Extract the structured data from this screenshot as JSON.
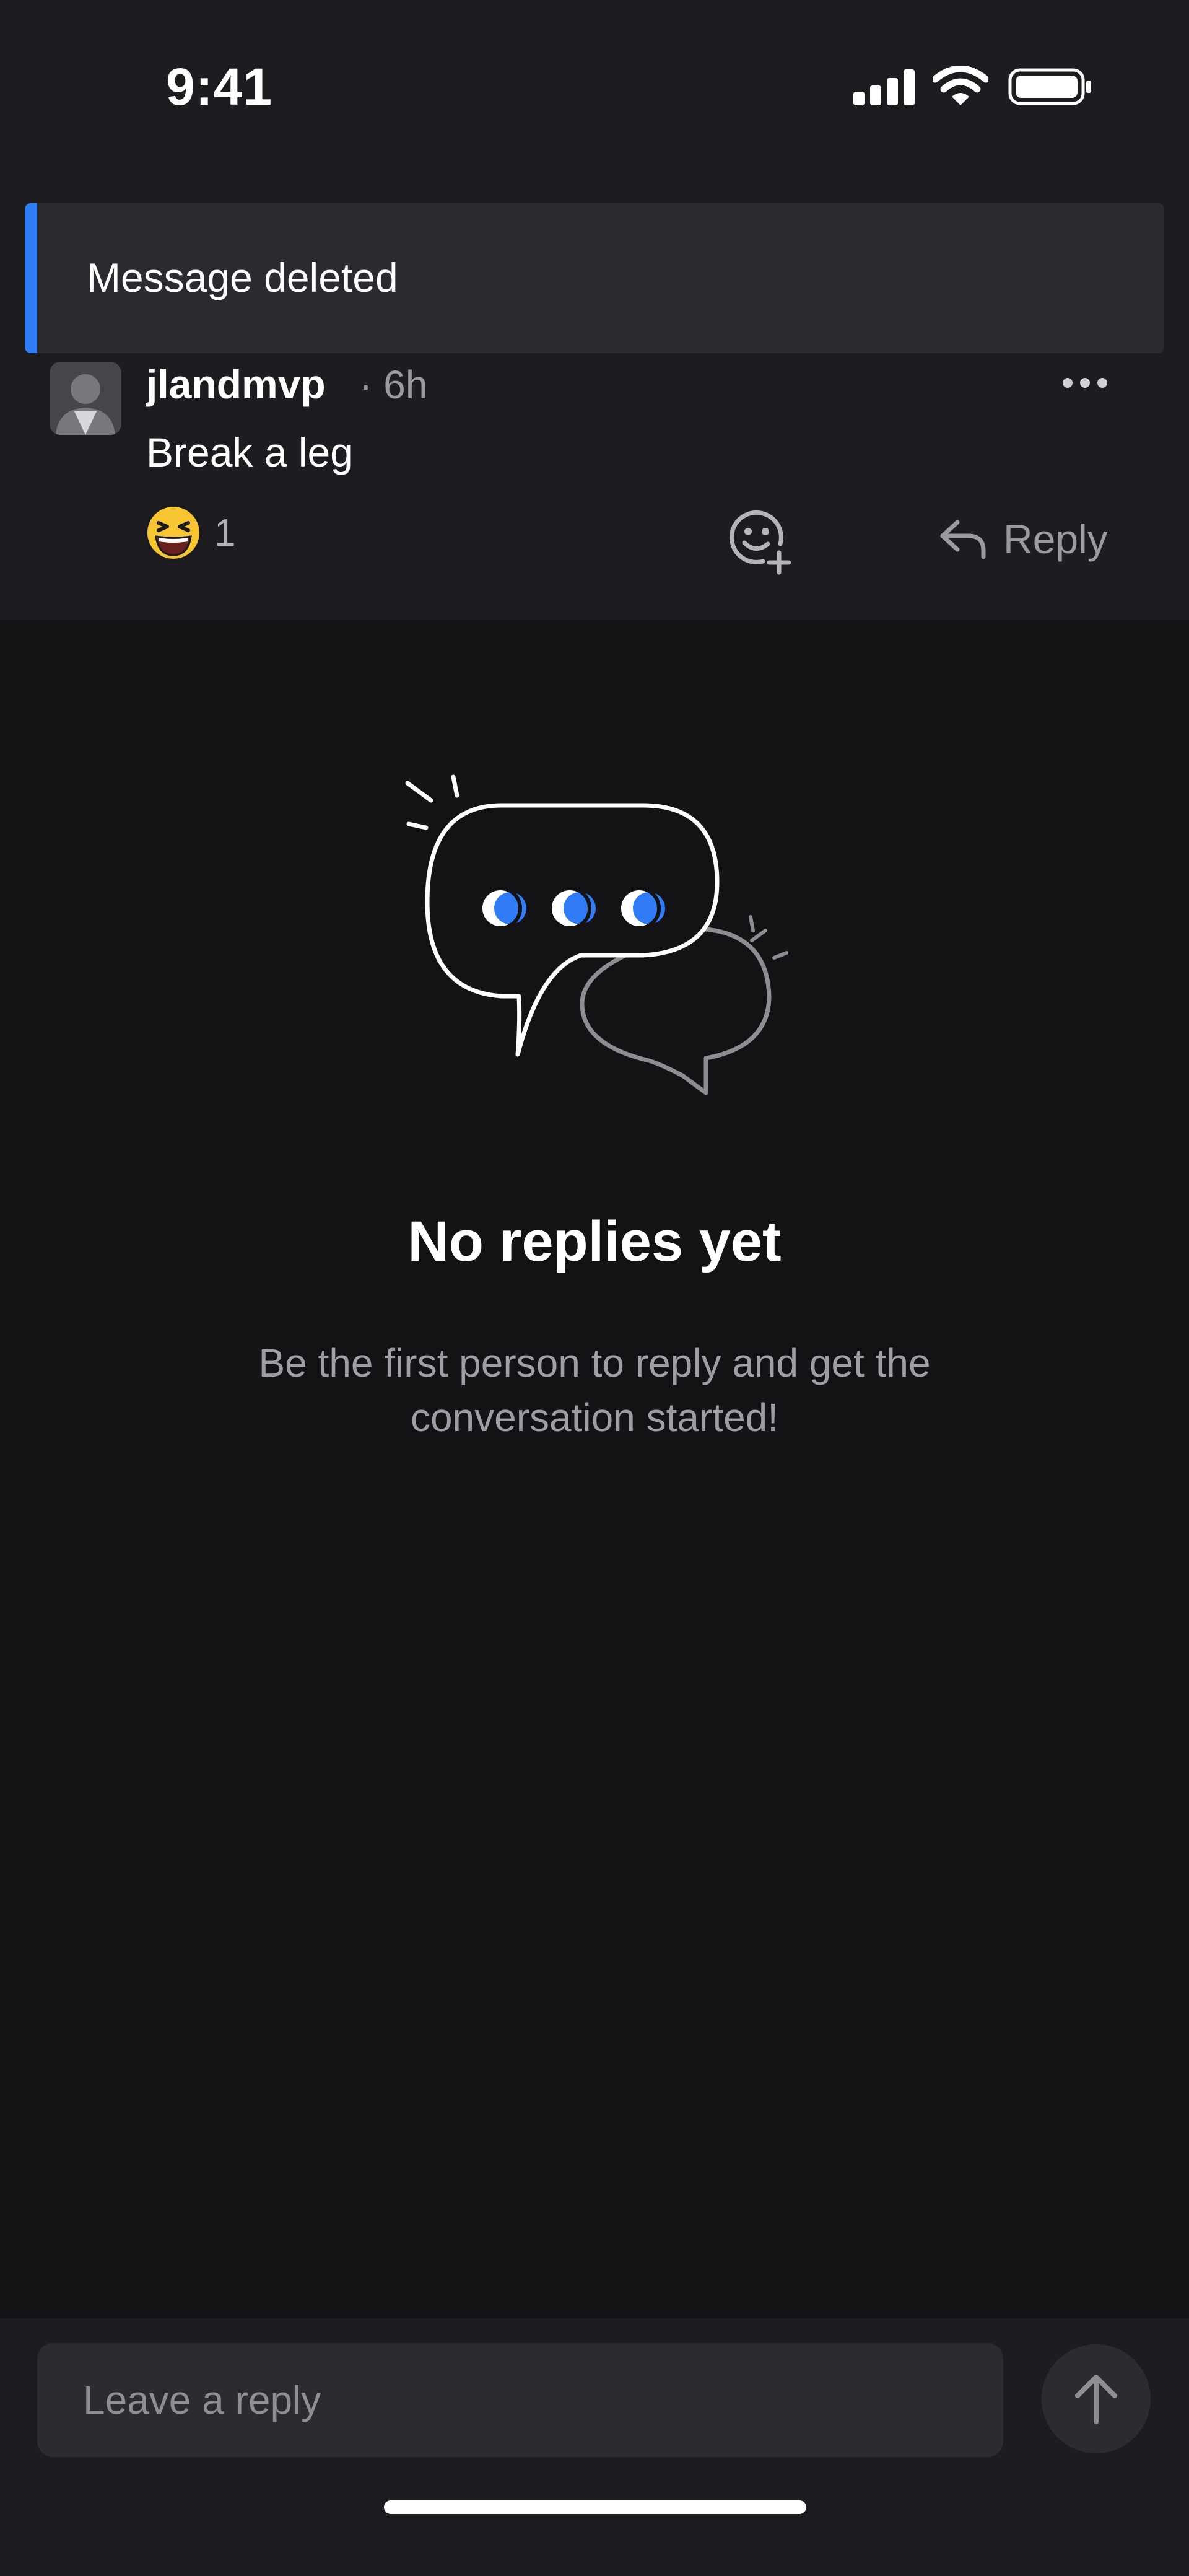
{
  "status_bar": {
    "time": "9:41",
    "icons": [
      "cellular-signal-icon",
      "wifi-icon",
      "battery-icon"
    ]
  },
  "deleted_banner": {
    "text": "Message deleted",
    "accent_color": "#2f7cf6"
  },
  "message": {
    "author": "jlandmvp",
    "time": "· 6h",
    "body": "Break a leg",
    "reaction": {
      "icon": "laughing-emoji-icon",
      "count": "1"
    },
    "add_reaction_icon": "add-emoji-icon",
    "reply_label": "Reply",
    "more_icon": "more-dots-icon"
  },
  "empty_state": {
    "illustration": "chat-bubbles-icon",
    "title": "No replies yet",
    "subtitle": "Be the first person to reply and get the conversation started!"
  },
  "composer": {
    "placeholder": "Leave a reply",
    "send_icon": "arrow-up-icon"
  },
  "colors": {
    "background": "#131315",
    "header_background": "#1d1d21",
    "accent": "#2f7cf6",
    "text_primary": "#ffffff",
    "text_secondary": "#9a9aa0"
  }
}
